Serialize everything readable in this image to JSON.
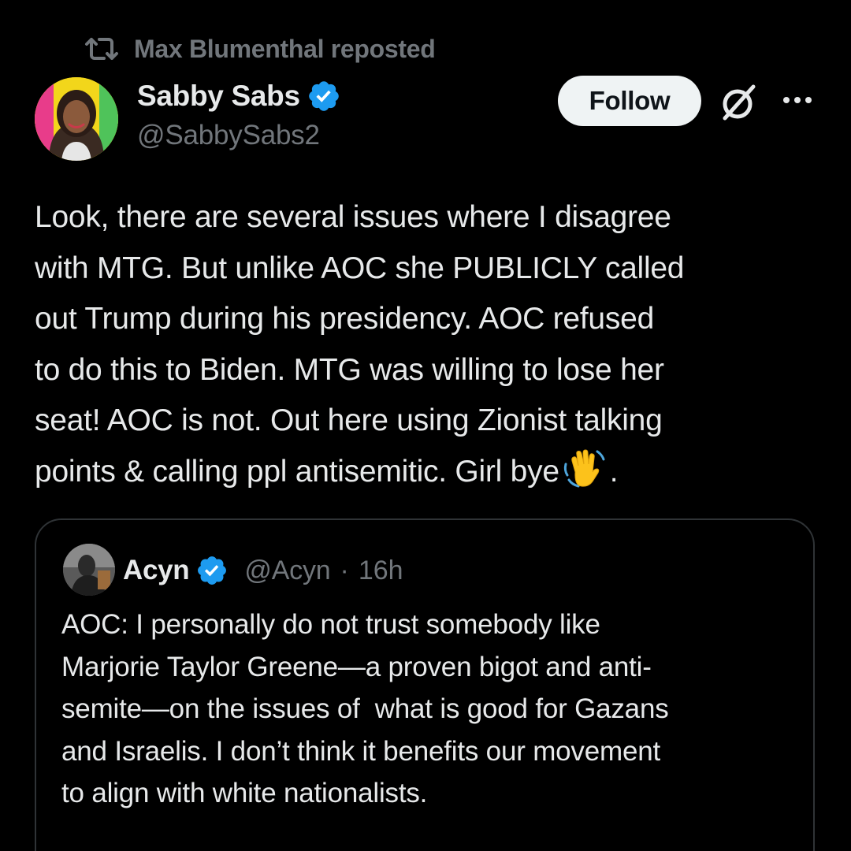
{
  "repost": {
    "label": "Max Blumenthal reposted",
    "icon": "repost-icon"
  },
  "author": {
    "display_name": "Sabby Sabs",
    "handle": "@SabbySabs2",
    "verified": true,
    "avatar_icon": "avatar"
  },
  "actions": {
    "follow_label": "Follow",
    "grok_icon": "grok-icon",
    "more_icon": "more-icon"
  },
  "tweet": {
    "lines": [
      "Look, there are several issues where I disagree",
      "with MTG. But unlike AOC she PUBLICLY called",
      "out Trump during his presidency. AOC refused",
      "to do this to Biden. MTG was willing to lose her",
      "seat! AOC is not. Out here using Zionist talking",
      "points & calling ppl antisemitic. Girl bye"
    ],
    "emoji": "waving-hand",
    "trailing": "."
  },
  "quote": {
    "display_name": "Acyn",
    "verified": true,
    "handle": "@Acyn",
    "separator": "·",
    "time": "16h",
    "lines": [
      "AOC: I personally do not trust somebody like",
      "Marjorie Taylor Greene—a proven bigot and anti-",
      "semite—on the issues of  what is good for Gazans",
      "and Israelis. I don’t think it benefits our movement",
      "to align with white nationalists."
    ]
  },
  "colors": {
    "background": "#000000",
    "text_primary": "#e7e9ea",
    "text_secondary": "#71767b",
    "verified_blue": "#1d9bf0",
    "follow_bg": "#eff3f4",
    "follow_text": "#0f1419",
    "border": "#2f3336"
  }
}
